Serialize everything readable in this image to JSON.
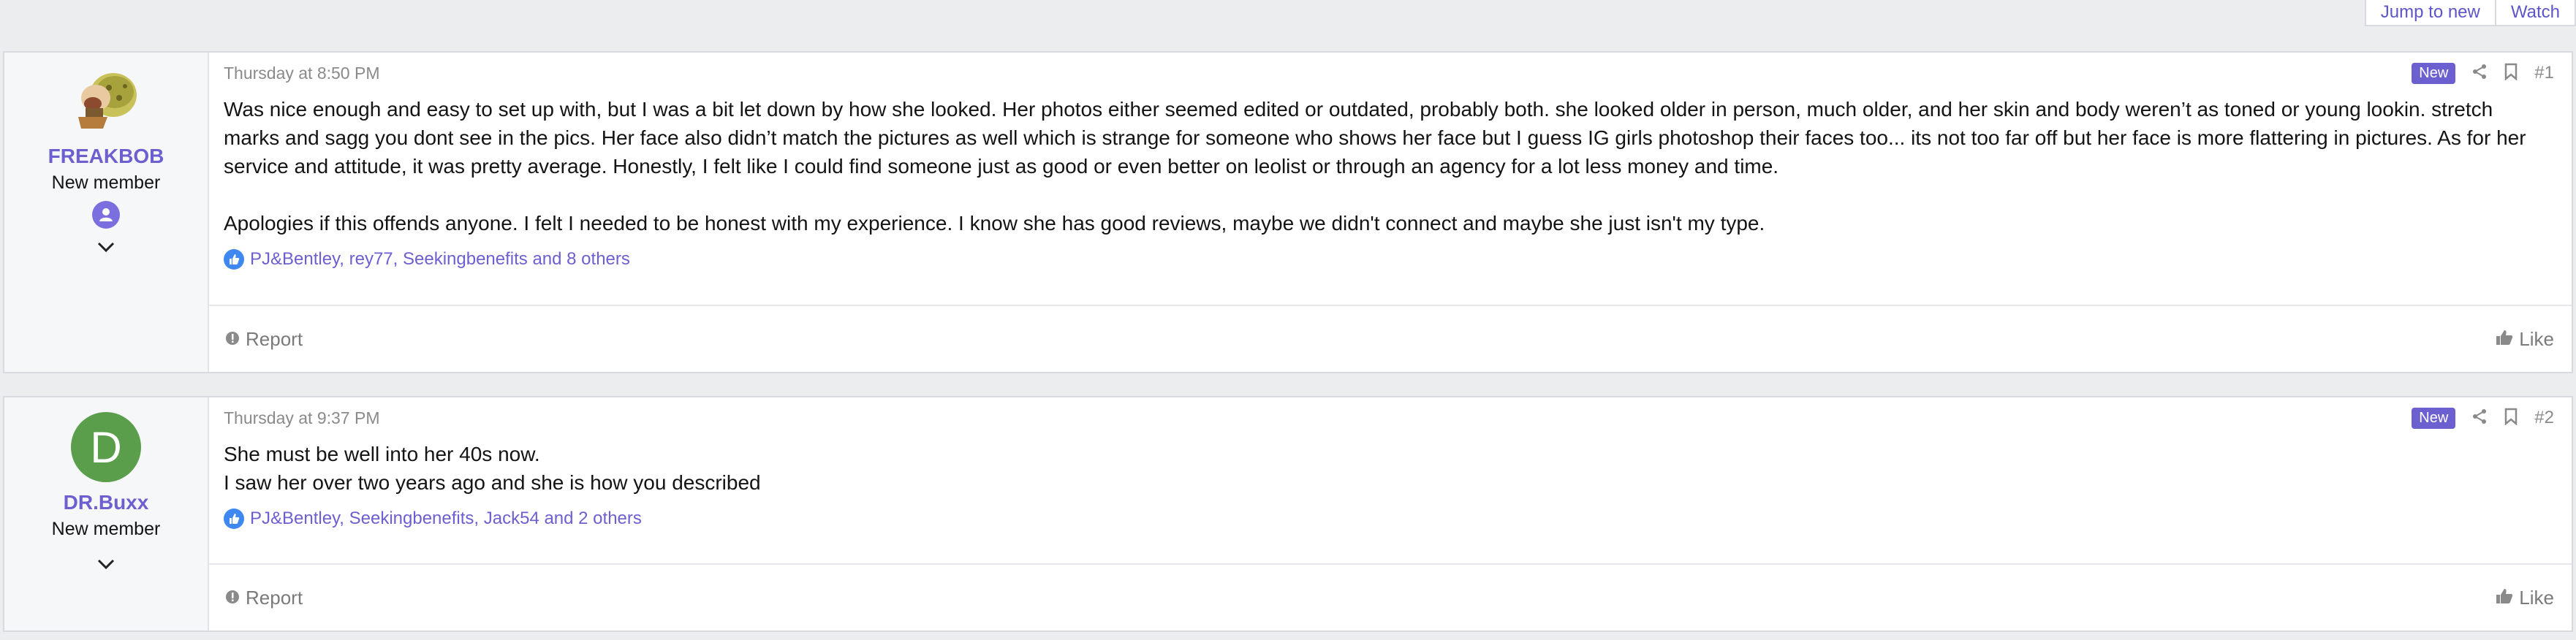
{
  "top_actions": {
    "jump_label": "Jump to new",
    "watch_label": "Watch"
  },
  "posts": [
    {
      "author": "FREAKBOB",
      "user_title": "New member",
      "date": "Thursday at 8:50 PM",
      "badge": "New",
      "post_number": "#1",
      "paragraphs": [
        "Was nice enough and easy to set up with, but I was a bit let down by how she looked. Her photos either seemed edited or outdated, probably both. she looked older in person, much older, and her skin and body weren’t as toned or young lookin. stretch marks and sagg you dont see in the pics. Her face also didn’t match the pictures as well which is strange for someone who shows her face but I guess IG girls photoshop their faces too... its not too far off but her face is more flattering in pictures. As for her service and attitude, it was pretty average. Honestly, I felt like I could find someone just as good or even better on leolist or through an agency for a lot less money and time.",
        "Apologies if this offends anyone. I felt I needed to be honest with my experience. I know she has good reviews, maybe we didn't connect and maybe she just isn't my type."
      ],
      "reactions": "PJ&Bentley, rey77, Seekingbenefits and 8 others",
      "report_label": "Report",
      "like_label": "Like"
    },
    {
      "author": "DR.Buxx",
      "avatar_letter": "D",
      "user_title": "New member",
      "date": "Thursday at 9:37 PM",
      "badge": "New",
      "post_number": "#2",
      "lines": [
        "She must be well into her 40s now.",
        "I saw her over two years ago and she is how you described"
      ],
      "reactions": "PJ&Bentley, Seekingbenefits, Jack54 and 2 others",
      "report_label": "Report",
      "like_label": "Like"
    }
  ],
  "colors": {
    "accent": "#6c5fd0",
    "avatar_green": "#5a9e4b",
    "like_blue": "#3f88f2"
  },
  "icons": [
    "share-icon",
    "bookmark-icon",
    "chevron-down-icon",
    "report-icon",
    "thumbs-up-icon",
    "user-badge-icon"
  ]
}
